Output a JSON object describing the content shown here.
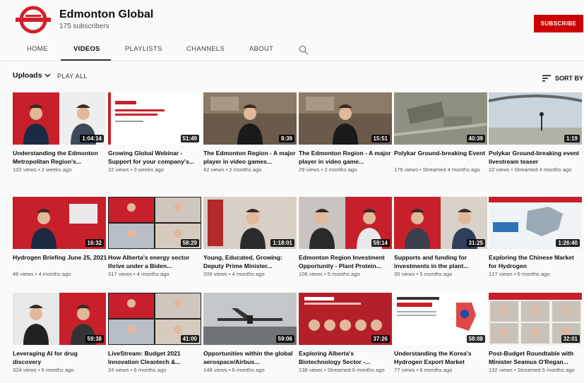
{
  "channel": {
    "name": "Edmonton Global",
    "subscribers": "175 subscribers",
    "subscribe_label": "SUBSCRIBE"
  },
  "tabs": [
    {
      "label": "HOME",
      "active": false
    },
    {
      "label": "VIDEOS",
      "active": true
    },
    {
      "label": "PLAYLISTS",
      "active": false
    },
    {
      "label": "CHANNELS",
      "active": false
    },
    {
      "label": "ABOUT",
      "active": false
    }
  ],
  "toolbar": {
    "uploads_label": "Uploads",
    "play_all_label": "PLAY ALL",
    "sort_label": "SORT BY"
  },
  "colors": {
    "brand_red": "#cc0000",
    "duration_bg": "#000000"
  },
  "videos": [
    {
      "title": "Understanding the Edmonton Metropolitan Region's...",
      "views": "102 views",
      "age": "2 weeks ago",
      "duration": "1:04:14",
      "thumb": "duo"
    },
    {
      "title": "Growing Global Webinar - Support for your company's...",
      "views": "22 views",
      "age": "3 weeks ago",
      "duration": "51:49",
      "thumb": "slide"
    },
    {
      "title": "The Edmonton Region - A major player in video games...",
      "views": "42 views",
      "age": "2 months ago",
      "duration": "8:39",
      "thumb": "man"
    },
    {
      "title": "The Edmonton Region - A major player in video game...",
      "views": "29 views",
      "age": "2 months ago",
      "duration": "15:51",
      "thumb": "man"
    },
    {
      "title": "Polykar Ground-breaking Event",
      "views": "176 views",
      "age": "Streamed 4 months ago",
      "duration": "40:39",
      "thumb": "aerial"
    },
    {
      "title": "Polykar Ground-breaking event livestream teaser",
      "views": "22 views",
      "age": "Streamed 4 months ago",
      "duration": "1:19",
      "thumb": "sky"
    },
    {
      "title": "Hydrogen Briefing June 25, 2021",
      "views": "46 views",
      "age": "4 months ago",
      "duration": "16:32",
      "thumb": "redman"
    },
    {
      "title": "How Alberta's energy sector thrive under a Biden...",
      "views": "317 views",
      "age": "4 months ago",
      "duration": "58:29",
      "thumb": "gridcall"
    },
    {
      "title": "Young, Educated, Growing: Deputy Prime Minister...",
      "views": "209 views",
      "age": "4 months ago",
      "duration": "1:18:01",
      "thumb": "woman"
    },
    {
      "title": "Edmonton Region Investment Opportunity - Plant Protein...",
      "views": "106 views",
      "age": "5 months ago",
      "duration": "59:14",
      "thumb": "duo2"
    },
    {
      "title": "Supports and funding for investments in the plant...",
      "views": "35 views",
      "age": "5 months ago",
      "duration": "31:25",
      "thumb": "duo3"
    },
    {
      "title": "Exploring the Chinese Market for Hydrogen",
      "views": "127 views",
      "age": "6 months ago",
      "duration": "1:26:40",
      "thumb": "map"
    },
    {
      "title": "Leveraging AI for drug discovery",
      "views": "324 views",
      "age": "6 months ago",
      "duration": "59:38",
      "thumb": "duo4"
    },
    {
      "title": "LiveStream: Budget 2021 Innovation Cleantech &...",
      "views": "24 views",
      "age": "6 months ago",
      "duration": "41:00",
      "thumb": "gridcall"
    },
    {
      "title": "Opportunities within the global aerospace/Airbus...",
      "views": "148 views",
      "age": "6 months ago",
      "duration": "59:06",
      "thumb": "plane"
    },
    {
      "title": "Exploring Alberta's Biotechnology Sector -...",
      "views": "138 views",
      "age": "Streamed 6 months ago",
      "duration": "37:26",
      "thumb": "livestream"
    },
    {
      "title": "Understanding the Korea's Hydrogen Export Market",
      "views": "77 views",
      "age": "6 months ago",
      "duration": "58:08",
      "thumb": "korea"
    },
    {
      "title": "Post-Budget Roundtable with Minister Seamus O'Regan...",
      "views": "132 views",
      "age": "Streamed 6 months ago",
      "duration": "32:01",
      "thumb": "gridcall2"
    }
  ]
}
